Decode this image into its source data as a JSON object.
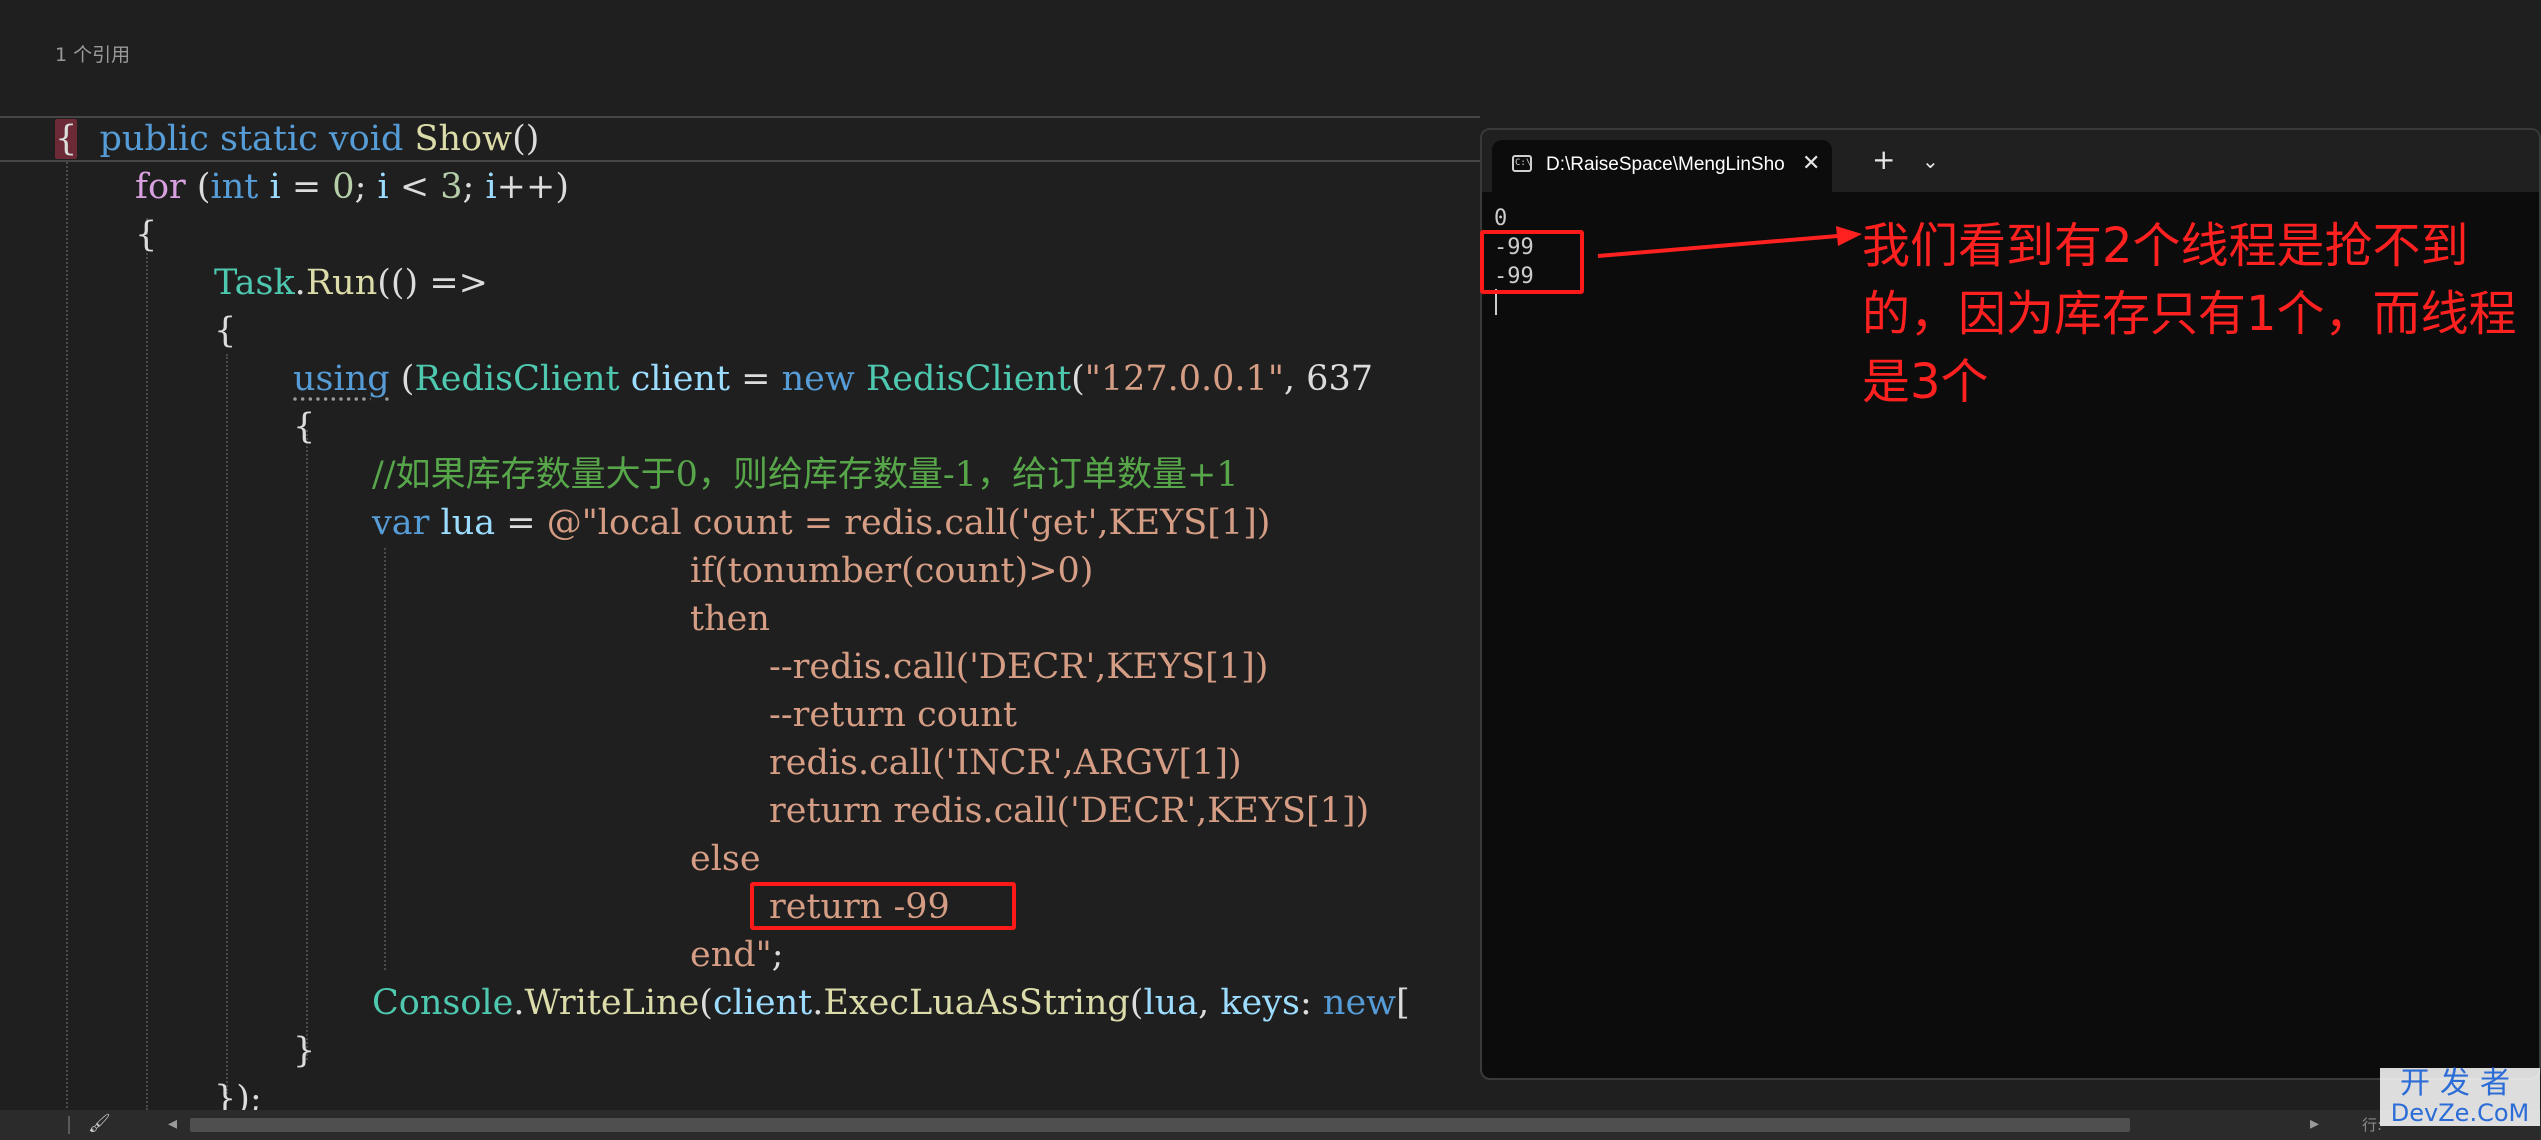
{
  "editor": {
    "codelens": "1 个引用",
    "lines": {
      "l1": {
        "kw1": "public",
        "kw2": "static",
        "kw3": "void",
        "fn": "Show",
        "punc": "()"
      },
      "l2": {
        "brace": "{"
      },
      "l3": {
        "ctl": "for",
        "punc1": " (",
        "kw": "int",
        "id1": "i",
        "op1": " = ",
        "num1": "0",
        "sep1": "; ",
        "id2": "i",
        "op2": " < ",
        "num2": "3",
        "sep2": "; ",
        "id3": "i",
        "op3": "++)"
      },
      "l4": {
        "brace": "{"
      },
      "l5": {
        "ty": "Task",
        "dot": ".",
        "fn": "Run",
        "rest": "(() =>"
      },
      "l6": {
        "brace": "{"
      },
      "l7": {
        "kw": "using",
        "punc1": " (",
        "ty": "RedisClient",
        "id": "client",
        "op": " = ",
        "kw2": "new",
        "ty2": "RedisClient",
        "punc2": "(",
        "str": "\"127.0.0.1\"",
        "rest": ", 637"
      },
      "l8": {
        "brace": "{"
      },
      "l9": {
        "comment": "//如果库存数量大于0，则给库存数量-1，给订单数量+1"
      },
      "l10": {
        "kw": "var",
        "id": "lua",
        "op": " = ",
        "str": "@\"local count = redis.call('get',KEYS[1])"
      },
      "l11": "if(tonumber(count)>0)",
      "l12": "then",
      "l13": "--redis.call('DECR',KEYS[1])",
      "l14": "--return count",
      "l15": "redis.call('INCR',ARGV[1])",
      "l16": "return redis.call('DECR',KEYS[1])",
      "l17": "else",
      "l18": "return -99",
      "l19": {
        "str": "end\"",
        "punc": ";"
      },
      "l20": {
        "ty": "Console",
        "dot": ".",
        "fn": "WriteLine",
        "punc1": "(",
        "id": "client",
        "dot2": ".",
        "fn2": "ExecLuaAsString",
        "punc2": "(",
        "id2": "lua",
        "punc3": ", ",
        "id3": "keys",
        "punc4": ": ",
        "kw": "new",
        "rest": "["
      },
      "l21": {
        "brace": "}"
      },
      "l22": {
        "rest": "});"
      }
    }
  },
  "terminal": {
    "tab_title": "D:\\RaiseSpace\\MengLinShopp",
    "tab_icon_text": "C:\\",
    "close_glyph": "✕",
    "new_tab_glyph": "+",
    "dropdown_glyph": "⌄",
    "output": [
      "0",
      "-99",
      "-99"
    ]
  },
  "annotation": {
    "text": "我们看到有2个线程是抢不到的，因为库存只有1个，而线程是3个",
    "color": "#ff2020"
  },
  "statusbar": {
    "brush_glyph": "🖌",
    "left_arrow": "◂",
    "right_arrow": "▸",
    "position_text": "行:"
  },
  "watermark": {
    "top": "开发者",
    "bottom": "DevZe.CoM"
  }
}
